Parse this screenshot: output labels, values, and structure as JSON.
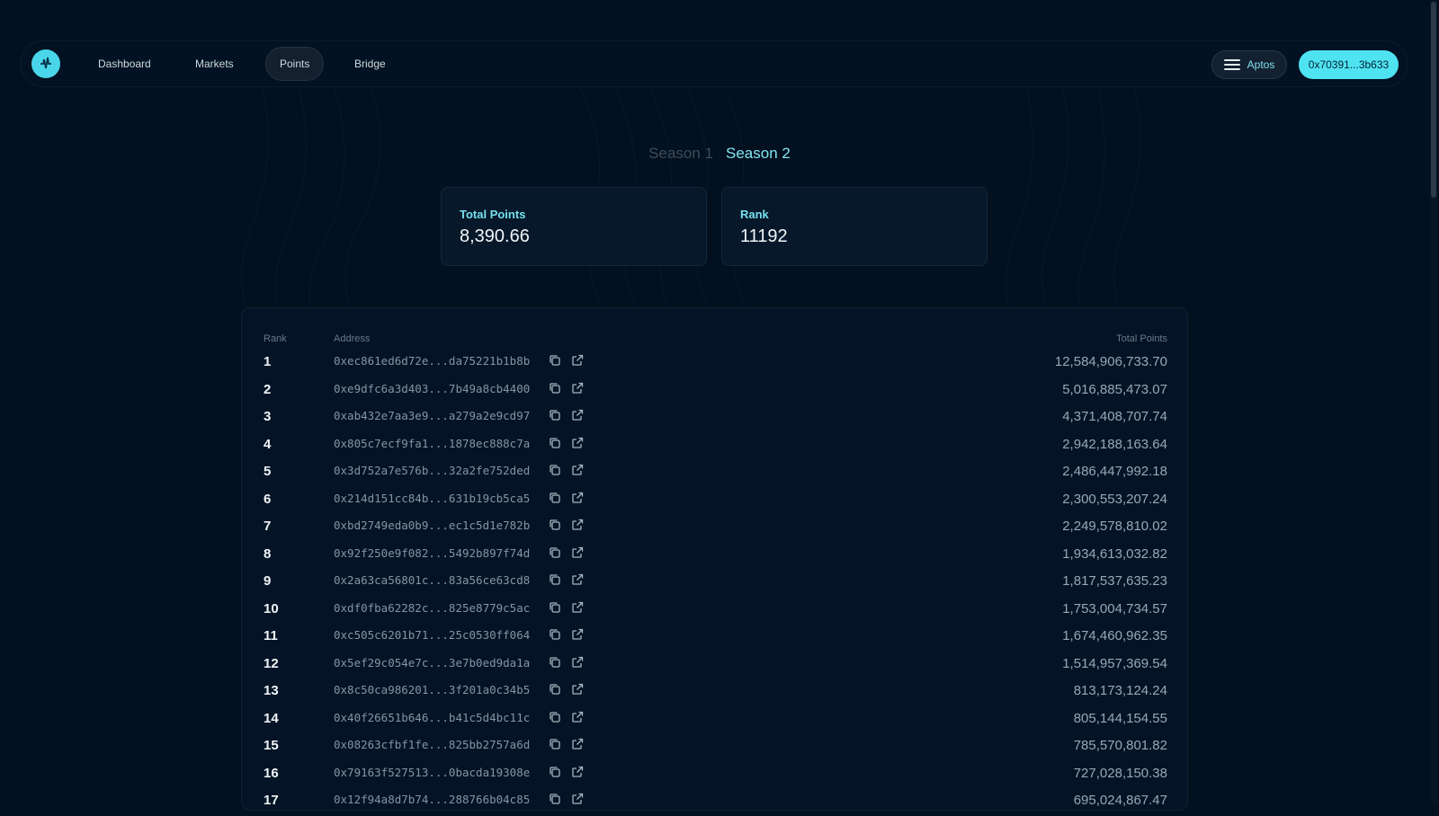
{
  "nav": {
    "items": [
      {
        "label": "Dashboard"
      },
      {
        "label": "Markets"
      },
      {
        "label": "Points"
      },
      {
        "label": "Bridge"
      }
    ],
    "active": "Points",
    "chain_label": "Aptos",
    "wallet_label": "0x70391...3b633"
  },
  "seasons": {
    "season1": "Season 1",
    "season2": "Season 2",
    "active": "Season 2"
  },
  "stats": {
    "total_points_label": "Total Points",
    "total_points_value": "8,390.66",
    "rank_label": "Rank",
    "rank_value": "11192"
  },
  "leaderboard": {
    "headers": {
      "rank": "Rank",
      "address": "Address",
      "points": "Total Points"
    },
    "rows": [
      {
        "rank": "1",
        "address": "0xec861ed6d72e...da75221b1b8b",
        "points": "12,584,906,733.70"
      },
      {
        "rank": "2",
        "address": "0xe9dfc6a3d403...7b49a8cb4400",
        "points": "5,016,885,473.07"
      },
      {
        "rank": "3",
        "address": "0xab432e7aa3e9...a279a2e9cd97",
        "points": "4,371,408,707.74"
      },
      {
        "rank": "4",
        "address": "0x805c7ecf9fa1...1878ec888c7a",
        "points": "2,942,188,163.64"
      },
      {
        "rank": "5",
        "address": "0x3d752a7e576b...32a2fe752ded",
        "points": "2,486,447,992.18"
      },
      {
        "rank": "6",
        "address": "0x214d151cc84b...631b19cb5ca5",
        "points": "2,300,553,207.24"
      },
      {
        "rank": "7",
        "address": "0xbd2749eda0b9...ec1c5d1e782b",
        "points": "2,249,578,810.02"
      },
      {
        "rank": "8",
        "address": "0x92f250e9f082...5492b897f74d",
        "points": "1,934,613,032.82"
      },
      {
        "rank": "9",
        "address": "0x2a63ca56801c...83a56ce63cd8",
        "points": "1,817,537,635.23"
      },
      {
        "rank": "10",
        "address": "0xdf0fba62282c...825e8779c5ac",
        "points": "1,753,004,734.57"
      },
      {
        "rank": "11",
        "address": "0xc505c6201b71...25c0530ff064",
        "points": "1,674,460,962.35"
      },
      {
        "rank": "12",
        "address": "0x5ef29c054e7c...3e7b0ed9da1a",
        "points": "1,514,957,369.54"
      },
      {
        "rank": "13",
        "address": "0x8c50ca986201...3f201a0c34b5",
        "points": "813,173,124.24"
      },
      {
        "rank": "14",
        "address": "0x40f26651b646...b41c5d4bc11c",
        "points": "805,144,154.55"
      },
      {
        "rank": "15",
        "address": "0x08263cfbf1fe...825bb2757a6d",
        "points": "785,570,801.82"
      },
      {
        "rank": "16",
        "address": "0x79163f527513...0bacda19308e",
        "points": "727,028,150.38"
      },
      {
        "rank": "17",
        "address": "0x12f94a8d7b74...288766b04c85",
        "points": "695,024,867.47"
      }
    ]
  },
  "colors": {
    "accent": "#4fe3f2",
    "background": "#03101f"
  },
  "icons": {
    "copy": "copy-icon",
    "external": "external-link-icon",
    "chain": "aptos-logo-icon",
    "logo": "app-logo-icon"
  }
}
